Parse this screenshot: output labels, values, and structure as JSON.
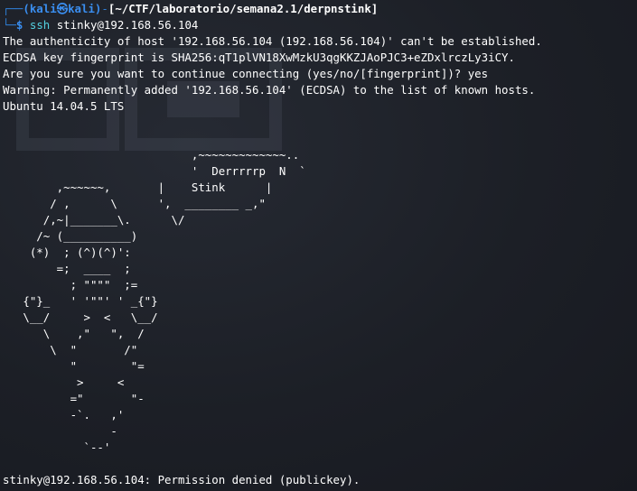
{
  "prompt": {
    "user_host": "(kali㉿kali)",
    "path": "[~/CTF/laboratorio/semana2.1/derpnstink]",
    "symbol": "$"
  },
  "command": {
    "name": "ssh",
    "args": " stinky@192.168.56.104"
  },
  "output": [
    "The authenticity of host '192.168.56.104 (192.168.56.104)' can't be established.",
    "ECDSA key fingerprint is SHA256:qT1plVN18XwMzkU3qgKKZJAoPJC3+eZDxlrczLy3iCY.",
    "Are you sure you want to continue connecting (yes/no/[fingerprint])? yes",
    "Warning: Permanently added '192.168.56.104' (ECDSA) to the list of known hosts.",
    "Ubuntu 14.04.5 LTS"
  ],
  "banner_ascii": "                            ,~~~~~~~~~~~~~..\n                            '  Derrrrrp  N  `\n        ,~~~~~~,       |    Stink      |\n       / ,      \\      ',  ________ _,\"\n      /,~|_______\\.      \\/\n     /~ (__________)\n    (*)  ; (^)(^)':\n        =;  ____  ;\n          ; \"\"\"\"  ;=\n   {\"}_   ' '\"\"' ' _{\"}\n   \\__/     >  <   \\__/\n      \\    ,\"   \",  /\n       \\  \"       /\"\n          \"        \"=\n           >     <\n          =\"       \"-\n          -`.   ,'\n                -\n            `--'",
  "final_message": "stinky@192.168.56.104: Permission denied (publickey).",
  "colors": {
    "background": "#1d1f25",
    "prompt_blue": "#3a8ef0",
    "command_cyan": "#54d1e0",
    "text": "#ffffff"
  }
}
